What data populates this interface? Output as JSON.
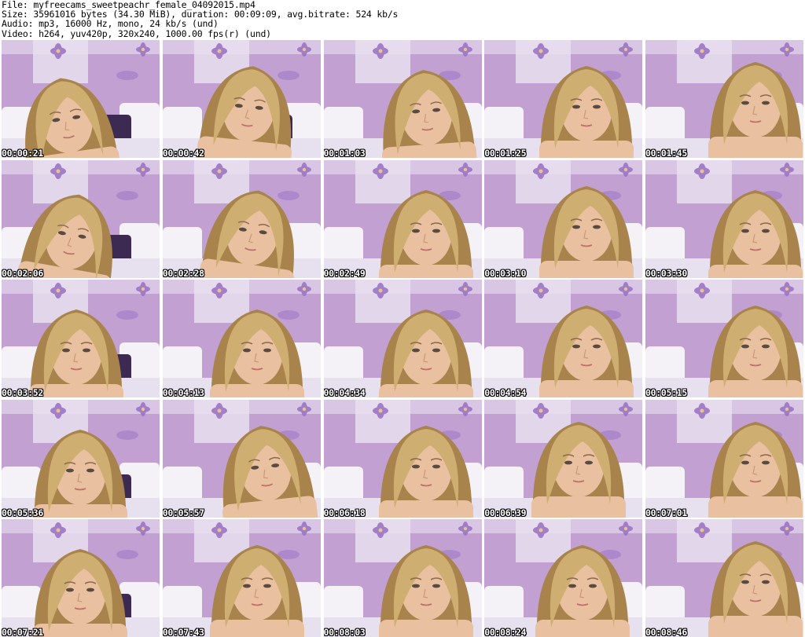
{
  "header": {
    "file_line": "File: myfreecams_sweetpeachr_female_04092015.mp4",
    "size_line": "Size: 35961016 bytes (34.30 MiB), duration: 00:09:09, avg.bitrate: 524 kb/s",
    "audio_line": "Audio: mp3, 16000 Hz, mono, 24 kb/s (und)",
    "video_line": "Video: h264, yuv420p, 320x240, 1000.00 fps(r) (und)"
  },
  "thumbnails": [
    {
      "time": "00:00:21"
    },
    {
      "time": "00:00:42"
    },
    {
      "time": "00:01:03"
    },
    {
      "time": "00:01:25"
    },
    {
      "time": "00:01:45"
    },
    {
      "time": "00:02:06"
    },
    {
      "time": "00:02:28"
    },
    {
      "time": "00:02:49"
    },
    {
      "time": "00:03:10"
    },
    {
      "time": "00:03:30"
    },
    {
      "time": "00:03:52"
    },
    {
      "time": "00:04:13"
    },
    {
      "time": "00:04:34"
    },
    {
      "time": "00:04:54"
    },
    {
      "time": "00:05:15"
    },
    {
      "time": "00:05:36"
    },
    {
      "time": "00:05:57"
    },
    {
      "time": "00:06:18"
    },
    {
      "time": "00:06:39"
    },
    {
      "time": "00:07:01"
    },
    {
      "time": "00:07:21"
    },
    {
      "time": "00:07:43"
    },
    {
      "time": "00:08:03"
    },
    {
      "time": "00:08:24"
    },
    {
      "time": "00:08:46"
    }
  ],
  "colors": {
    "wall": "#c2a1d2",
    "wall_light": "#e7dff0",
    "flower": "#9b75c4",
    "pillow_white": "#f4f2f6",
    "pillow_dark": "#3d2a52",
    "hair": "#cfae72",
    "hair_dark": "#a8844c",
    "skin": "#e9c0a0",
    "timestamp_text": "#ffffff"
  }
}
